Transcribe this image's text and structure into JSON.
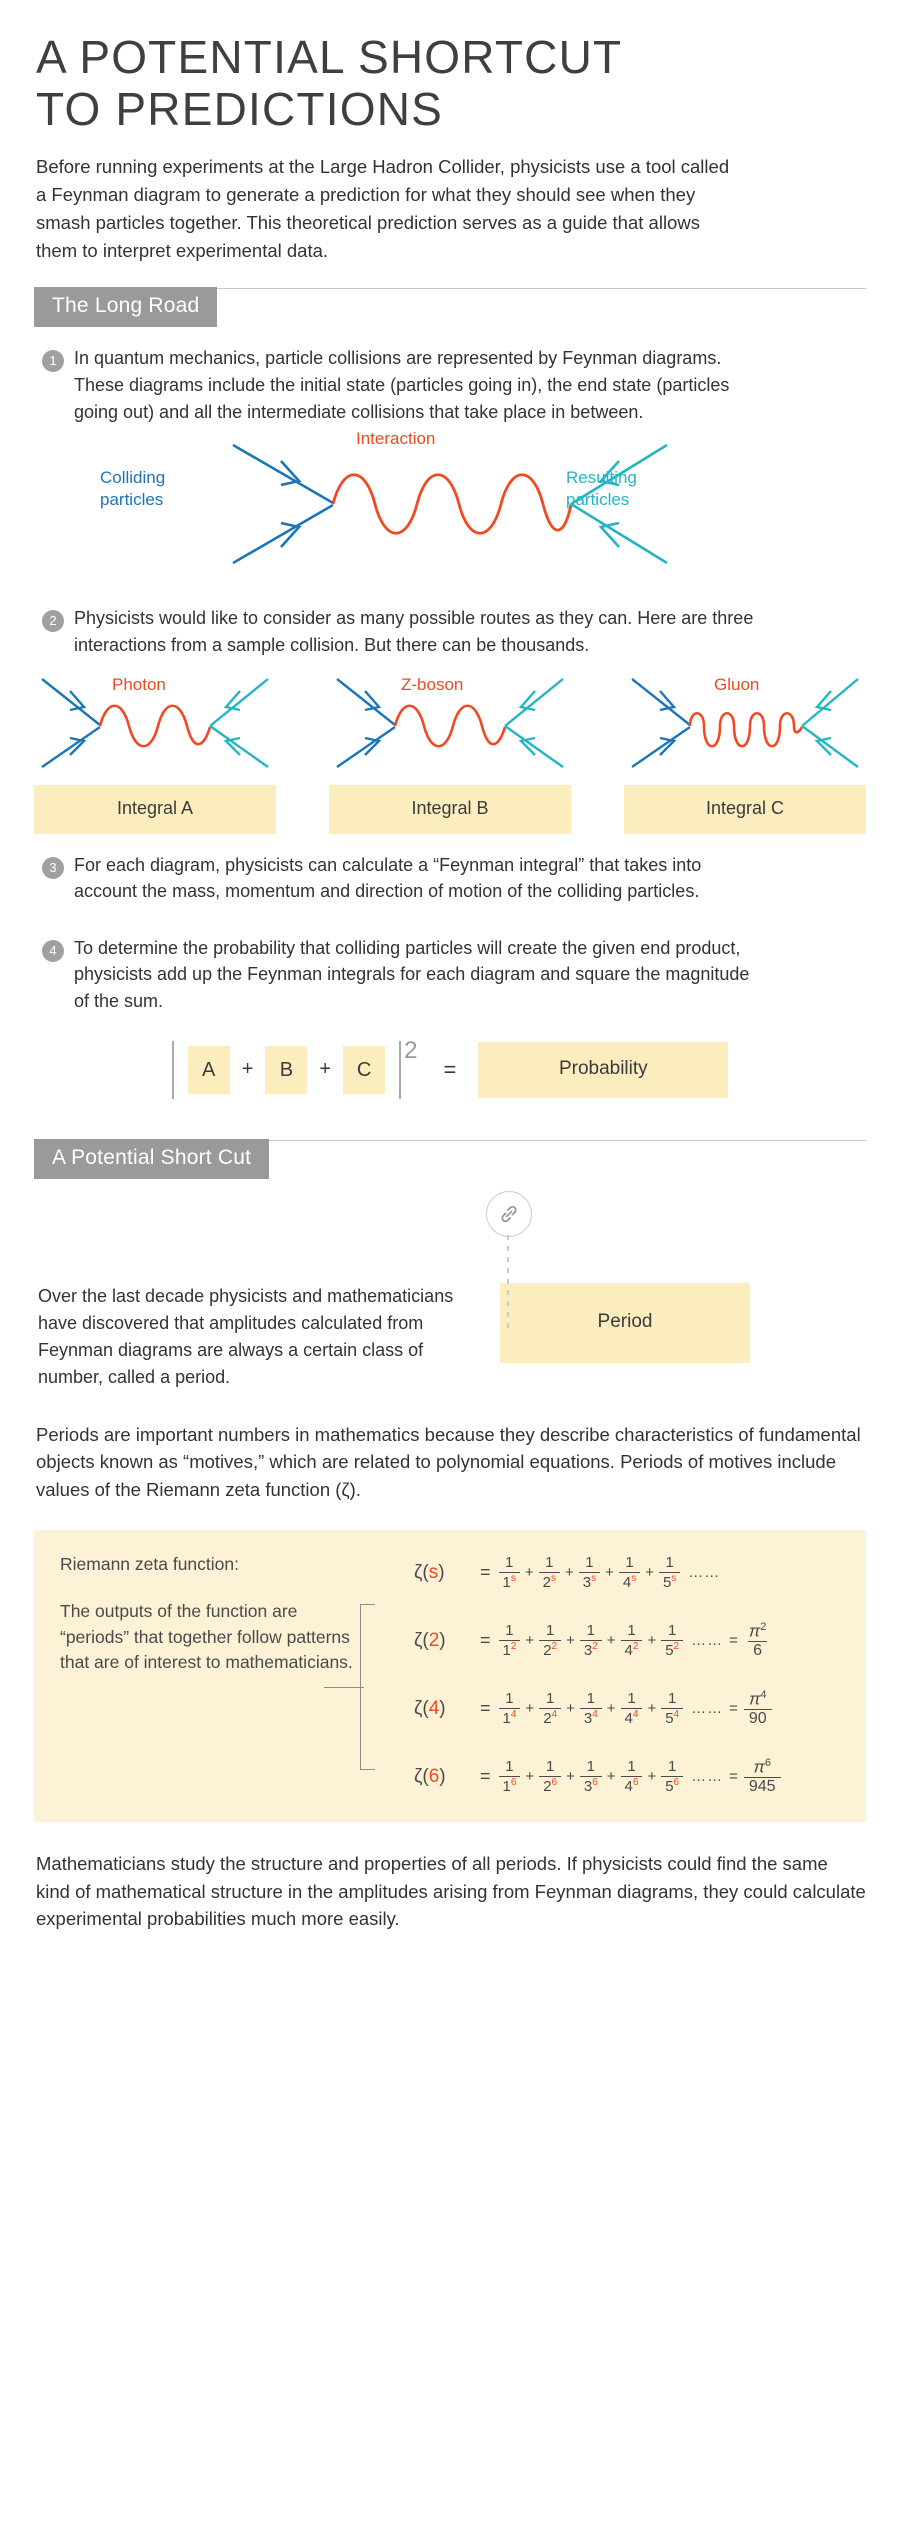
{
  "title": {
    "line1": "A POTENTIAL SHORTCUT",
    "line2": "TO PREDICTIONS"
  },
  "intro": "Before running experiments at the Large Hadron Collider, physicists use a tool called a Feynman diagram to generate a prediction for what they should see when they smash particles together. This theoretical prediction serves as a guide that allows them to interpret experimental data.",
  "sections": {
    "long_road": "The Long Road",
    "short_cut": "A Potential Short Cut"
  },
  "steps": [
    {
      "num": "1",
      "text": "In quantum mechanics, particle collisions are represented by Feynman diagrams. These diagrams include the initial state (particles going in), the end state (particles going out) and all the intermediate collisions that take place in between."
    },
    {
      "num": "2",
      "text": "Physicists would like to consider as many possible routes as they can. Here are three interactions from a sample collision. But there can be thousands."
    },
    {
      "num": "3",
      "text": "For each diagram, physicists can calculate a “Feynman integral” that takes into account the mass, momentum and direction of motion of the colliding particles."
    },
    {
      "num": "4",
      "text": "To determine the probability that colliding particles will create the given end product, physicists add up the Feynman integrals for each diagram and square the magnitude of the sum."
    }
  ],
  "diagram_main": {
    "label_left": "Colliding\nparticles",
    "label_left_line1": "Colliding",
    "label_left_line2": "particles",
    "label_center": "Interaction",
    "label_right_line1": "Resulting",
    "label_right_line2": "particles"
  },
  "trio": [
    {
      "particle": "Photon",
      "integral": "Integral A",
      "propagator": "wave"
    },
    {
      "particle": "Z-boson",
      "integral": "Integral B",
      "propagator": "wave"
    },
    {
      "particle": "Gluon",
      "integral": "Integral C",
      "propagator": "coil"
    }
  ],
  "equation": {
    "term_a": "A",
    "term_b": "B",
    "term_c": "C",
    "plus": "+",
    "exponent": "2",
    "equals": "=",
    "result": "Probability"
  },
  "shortcut": {
    "body": "Over the last decade physicists and mathematicians have discovered that amplitudes calculated from Feynman diagrams are always a certain class of number, called a period.",
    "box": "Period",
    "icon": "link-icon"
  },
  "periods_paragraph": "Periods are important numbers in mathematics because they describe characteristics of fundamental objects known as “motives,” which are related to polynomial equations. Periods of motives include values of the Riemann zeta function (ζ).",
  "zeta_panel": {
    "label_top": "Riemann zeta function:",
    "label_body": "The outputs of the function are “periods” that together follow patterns that are of interest to mathematicians.",
    "equations": [
      {
        "name_prefix": "ζ(",
        "name_arg": "s",
        "name_suffix": ")",
        "equals": "=",
        "terms": [
          {
            "num": "1",
            "den": "1",
            "exp": "s"
          },
          {
            "num": "1",
            "den": "2",
            "exp": "s"
          },
          {
            "num": "1",
            "den": "3",
            "exp": "s"
          },
          {
            "num": "1",
            "den": "4",
            "exp": "s"
          },
          {
            "num": "1",
            "den": "5",
            "exp": "s"
          }
        ],
        "dots": "……",
        "result": null,
        "result_num": "",
        "result_num_exp": "",
        "result_den": ""
      },
      {
        "name_prefix": "ζ(",
        "name_arg": "2",
        "name_suffix": ")",
        "equals": "=",
        "terms": [
          {
            "num": "1",
            "den": "1",
            "exp": "2"
          },
          {
            "num": "1",
            "den": "2",
            "exp": "2"
          },
          {
            "num": "1",
            "den": "3",
            "exp": "2"
          },
          {
            "num": "1",
            "den": "4",
            "exp": "2"
          },
          {
            "num": "1",
            "den": "5",
            "exp": "2"
          }
        ],
        "dots": "……",
        "result": "=",
        "result_num": "π",
        "result_num_exp": "2",
        "result_den": "6"
      },
      {
        "name_prefix": "ζ(",
        "name_arg": "4",
        "name_suffix": ")",
        "equals": "=",
        "terms": [
          {
            "num": "1",
            "den": "1",
            "exp": "4"
          },
          {
            "num": "1",
            "den": "2",
            "exp": "4"
          },
          {
            "num": "1",
            "den": "3",
            "exp": "4"
          },
          {
            "num": "1",
            "den": "4",
            "exp": "4"
          },
          {
            "num": "1",
            "den": "5",
            "exp": "4"
          }
        ],
        "dots": "……",
        "result": "=",
        "result_num": "π",
        "result_num_exp": "4",
        "result_den": "90"
      },
      {
        "name_prefix": "ζ(",
        "name_arg": "6",
        "name_suffix": ")",
        "equals": "=",
        "terms": [
          {
            "num": "1",
            "den": "1",
            "exp": "6"
          },
          {
            "num": "1",
            "den": "2",
            "exp": "6"
          },
          {
            "num": "1",
            "den": "3",
            "exp": "6"
          },
          {
            "num": "1",
            "den": "4",
            "exp": "6"
          },
          {
            "num": "1",
            "den": "5",
            "exp": "6"
          }
        ],
        "dots": "……",
        "result": "=",
        "result_num": "π",
        "result_num_exp": "6",
        "result_den": "945"
      }
    ],
    "plus": "+"
  },
  "footer": "Mathematicians study the structure and properties of all periods. If physicists could find the same kind of mathematical structure in the amplitudes arising from Feynman diagrams, they could calculate experimental probabilities much more easily.",
  "colors": {
    "accent_orange": "#f04a23",
    "blue_in": "#1b76b8",
    "teal_out": "#24b5c4",
    "banner_gray": "#9a9a9a",
    "panel_yellow": "#fdf2d6",
    "box_yellow": "#fcedbe",
    "text": "#333333"
  }
}
